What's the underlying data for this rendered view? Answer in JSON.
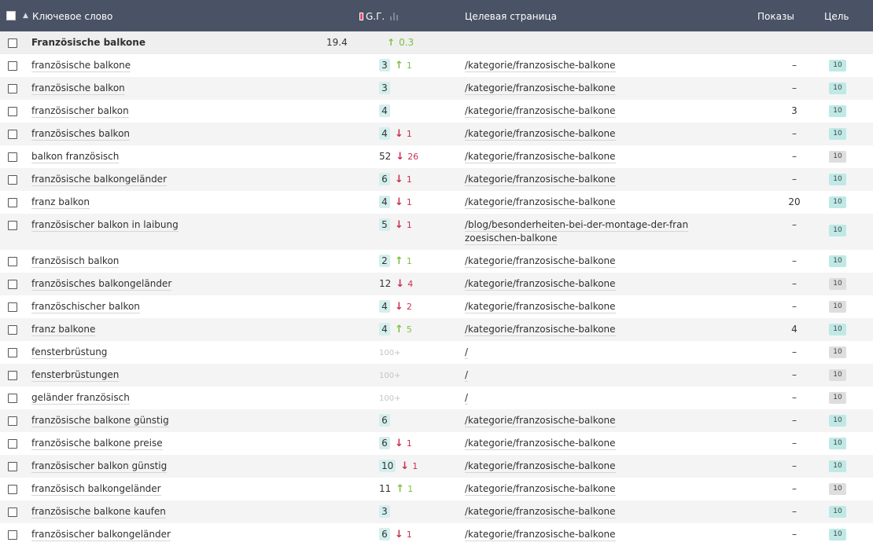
{
  "header": {
    "keyword_label": "Ключевое слово",
    "sort_arrow": "▲",
    "gt_label": "G.Г.",
    "target_label": "Целевая страница",
    "shows_label": "Показы",
    "goal_label": "Цель"
  },
  "group": {
    "name": "Französische balkone",
    "value": "19.4",
    "change_arrow": "↑",
    "change": "0.3"
  },
  "rows": [
    {
      "keyword": "französische balkone",
      "pos": "3",
      "pos_style": "box",
      "dir": "up",
      "change": "1",
      "url": "/kategorie/franzosische-balkone",
      "shows": "–",
      "goal": "10",
      "goal_style": "teal"
    },
    {
      "keyword": "französische balkon",
      "pos": "3",
      "pos_style": "box",
      "dir": "",
      "change": "",
      "url": "/kategorie/franzosische-balkone",
      "shows": "–",
      "goal": "10",
      "goal_style": "teal"
    },
    {
      "keyword": "französischer balkon",
      "pos": "4",
      "pos_style": "box",
      "dir": "",
      "change": "",
      "url": "/kategorie/franzosische-balkone",
      "shows": "3",
      "goal": "10",
      "goal_style": "teal"
    },
    {
      "keyword": "französisches balkon",
      "pos": "4",
      "pos_style": "box",
      "dir": "down",
      "change": "1",
      "url": "/kategorie/franzosische-balkone",
      "shows": "–",
      "goal": "10",
      "goal_style": "teal"
    },
    {
      "keyword": "balkon französisch",
      "pos": "52",
      "pos_style": "plain",
      "dir": "down",
      "change": "26",
      "url": "/kategorie/franzosische-balkone",
      "shows": "–",
      "goal": "10",
      "goal_style": "grey"
    },
    {
      "keyword": "französische balkongeländer",
      "pos": "6",
      "pos_style": "box",
      "dir": "down",
      "change": "1",
      "url": "/kategorie/franzosische-balkone",
      "shows": "–",
      "goal": "10",
      "goal_style": "teal"
    },
    {
      "keyword": "franz balkon",
      "pos": "4",
      "pos_style": "box",
      "dir": "down",
      "change": "1",
      "url": "/kategorie/franzosische-balkone",
      "shows": "20",
      "goal": "10",
      "goal_style": "teal"
    },
    {
      "keyword": "französischer balkon in laibung",
      "pos": "5",
      "pos_style": "box",
      "dir": "down",
      "change": "1",
      "url_line1": "/blog/besonderheiten-bei-der-montage-der-fran",
      "url_line2": "zoesischen-balkone",
      "shows": "–",
      "goal": "10",
      "goal_style": "teal",
      "tall": true
    },
    {
      "keyword": "französisch balkon",
      "pos": "2",
      "pos_style": "box",
      "dir": "up",
      "change": "1",
      "url": "/kategorie/franzosische-balkone",
      "shows": "–",
      "goal": "10",
      "goal_style": "teal"
    },
    {
      "keyword": "französisches balkongeländer",
      "pos": "12",
      "pos_style": "plain",
      "dir": "down",
      "change": "4",
      "url": "/kategorie/franzosische-balkone",
      "shows": "–",
      "goal": "10",
      "goal_style": "grey"
    },
    {
      "keyword": "französchischer balkon",
      "pos": "4",
      "pos_style": "box",
      "dir": "down",
      "change": "2",
      "url": "/kategorie/franzosische-balkone",
      "shows": "–",
      "goal": "10",
      "goal_style": "grey"
    },
    {
      "keyword": "franz balkone",
      "pos": "4",
      "pos_style": "box",
      "dir": "up",
      "change": "5",
      "url": "/kategorie/franzosische-balkone",
      "shows": "4",
      "goal": "10",
      "goal_style": "teal"
    },
    {
      "keyword": "fensterbrüstung",
      "pos": "100+",
      "pos_style": "hundred",
      "dir": "",
      "change": "",
      "url": "/",
      "shows": "–",
      "goal": "10",
      "goal_style": "grey"
    },
    {
      "keyword": "fensterbrüstungen",
      "pos": "100+",
      "pos_style": "hundred",
      "dir": "",
      "change": "",
      "url": "/",
      "shows": "–",
      "goal": "10",
      "goal_style": "grey"
    },
    {
      "keyword": "geländer französisch",
      "pos": "100+",
      "pos_style": "hundred",
      "dir": "",
      "change": "",
      "url": "/",
      "shows": "–",
      "goal": "10",
      "goal_style": "grey"
    },
    {
      "keyword": "französische balkone günstig",
      "pos": "6",
      "pos_style": "box",
      "dir": "",
      "change": "",
      "url": "/kategorie/franzosische-balkone",
      "shows": "–",
      "goal": "10",
      "goal_style": "teal"
    },
    {
      "keyword": "französische balkone preise",
      "pos": "6",
      "pos_style": "box",
      "dir": "down",
      "change": "1",
      "url": "/kategorie/franzosische-balkone",
      "shows": "–",
      "goal": "10",
      "goal_style": "teal"
    },
    {
      "keyword": "französischer balkon günstig",
      "pos": "10",
      "pos_style": "box",
      "dir": "down",
      "change": "1",
      "url": "/kategorie/franzosische-balkone",
      "shows": "–",
      "goal": "10",
      "goal_style": "teal"
    },
    {
      "keyword": "französisch balkongeländer",
      "pos": "11",
      "pos_style": "plain",
      "dir": "up",
      "change": "1",
      "url": "/kategorie/franzosische-balkone",
      "shows": "–",
      "goal": "10",
      "goal_style": "grey"
    },
    {
      "keyword": "französische balkone kaufen",
      "pos": "3",
      "pos_style": "box",
      "dir": "",
      "change": "",
      "url": "/kategorie/franzosische-balkone",
      "shows": "–",
      "goal": "10",
      "goal_style": "teal"
    },
    {
      "keyword": "französischer balkongeländer",
      "pos": "6",
      "pos_style": "box",
      "dir": "down",
      "change": "1",
      "url": "/kategorie/franzosische-balkone",
      "shows": "–",
      "goal": "10",
      "goal_style": "teal"
    }
  ],
  "colors": {
    "header_bg": "#4a5266",
    "up": "#7cbf3e",
    "down": "#c9304f",
    "pos_box": "#d4efed",
    "goal_teal": "#bfe9e6",
    "goal_grey": "#dedede"
  }
}
